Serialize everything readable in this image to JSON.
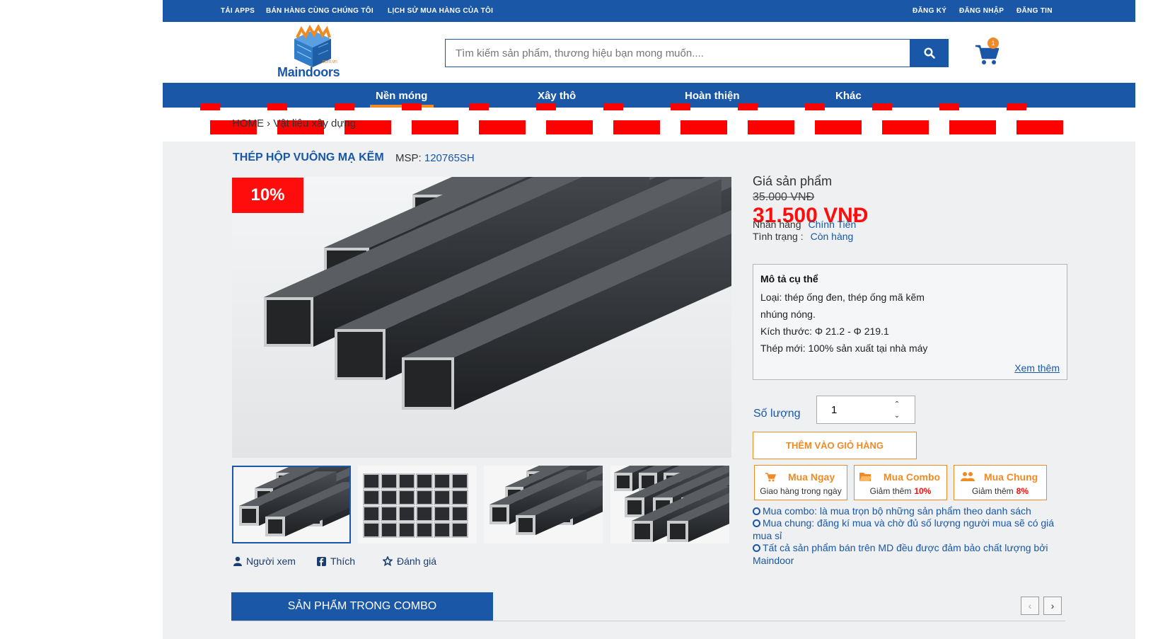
{
  "topbar": {
    "left_links": [
      "TẢI APPS",
      "BÁN HÀNG CÙNG CHÚNG TÔI",
      "LỊCH SỬ MUA HÀNG CỦA TÔI"
    ],
    "right_links": [
      "ĐĂNG KÝ",
      "ĐĂNG NHẬP",
      "ĐĂNG TIN"
    ]
  },
  "header": {
    "logo_text": "Maindoors",
    "logo_sub": ".com.vn",
    "search_placeholder": "Tìm kiếm sản phẩm, thương hiệu bạn mong muốn....",
    "cart_count": "1"
  },
  "nav": {
    "items": [
      "Nền móng",
      "Xây thô",
      "Hoàn thiện",
      "Khác"
    ],
    "active": "Nền móng"
  },
  "breadcrumb": {
    "text": "HOME  ›   Vật liệu xây dựng"
  },
  "product": {
    "title": "THÉP HỘP VUÔNG MẠ KẼM",
    "msp_label": "MSP:",
    "msp_value": "120765SH",
    "discount_badge": "10%",
    "social": [
      "Người xem",
      "Thích",
      "Đánh giá"
    ],
    "combo_section_title": "SẢN PHẨM TRONG COMBO"
  },
  "pricing": {
    "label": "Giá sản phẩm",
    "old_price": "35.000 VNĐ",
    "new_price": "31.500 VNĐ",
    "brand_label": "Nhãn hàng",
    "brand_value": "Chính Tiến",
    "status_label": "Tình trạng :",
    "status_value": "Còn hàng"
  },
  "description": {
    "heading": "Mô tả cụ thể",
    "line1": "Loại: thép ống đen, thép ống mã kẽm",
    "line2": "nhúng nóng.",
    "line3": "Kích thước: Φ 21.2 - Φ 219.1",
    "line4": "Thép mới: 100% sản xuất tại nhà máy",
    "more": "Xem thêm"
  },
  "purchase": {
    "qty_label": "Số lượng",
    "qty_value": "1",
    "add_to_cart": "THÊM VÀO GIỎ HÀNG",
    "buy_now_title": "Mua Ngay",
    "buy_now_sub": "Giao hàng trong ngày",
    "combo_title": "Mua Combo",
    "combo_sub": "Giảm thêm",
    "combo_pct": "10%",
    "group_title": "Mua Chung",
    "group_sub": "Giảm thêm",
    "group_pct": "8%"
  },
  "notes": [
    "Mua combo: là mua trọn bộ những sản phẩm theo danh sách",
    "Mua chung: đăng kí mua và chờ đủ số lượng người mua sẽ có giá mua sỉ",
    "Tất cả sản phẩm bán trên MD đều được đảm bảo chất lượng bởi Maindoor"
  ],
  "colors": {
    "brand_blue": "#1a57a7",
    "accent_orange": "#f08a24",
    "sale_red": "#ff0d0d"
  }
}
